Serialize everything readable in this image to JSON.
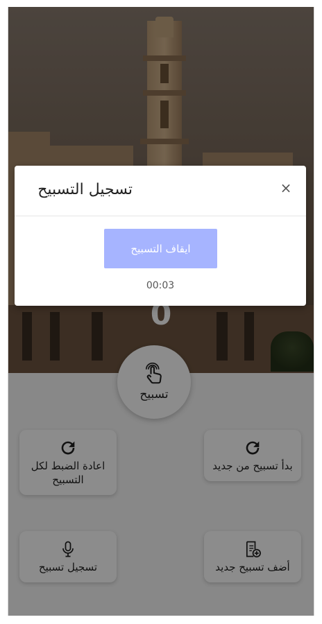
{
  "main": {
    "counter": "0",
    "tasbeeh_button": {
      "label": "تسبيح",
      "icon": "tap-hand-icon"
    },
    "cards": {
      "reset_all": {
        "label": "اعادة الضبط لكل التسبيح",
        "icon": "refresh-icon"
      },
      "restart": {
        "label": "بدأ تسبيح من جديد",
        "icon": "refresh-icon"
      },
      "record": {
        "label": "تسجيل تسبيح",
        "icon": "microphone-icon"
      },
      "add_new": {
        "label": "أضف تسبيح جديد",
        "icon": "add-document-icon"
      }
    }
  },
  "modal": {
    "title": "تسجيل التسبيح",
    "close_label": "×",
    "stop_button": "ايقاف التسبيح",
    "timer": "00:03"
  },
  "colors": {
    "accent": "#a6b4ff",
    "overlay": "rgba(0,0,0,0.45)"
  }
}
